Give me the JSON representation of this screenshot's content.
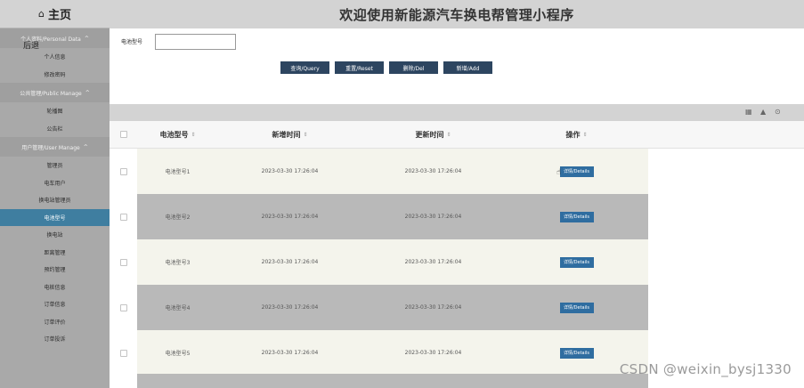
{
  "sidebar": {
    "home_label": "主页",
    "back_label": "后退",
    "groups": [
      {
        "label": "个人资料/Personal Data",
        "items": [
          {
            "label": "个人信息",
            "active": false
          },
          {
            "label": "修改密码",
            "active": false
          }
        ]
      },
      {
        "label": "公共管理/Public Manage",
        "items": [
          {
            "label": "轮播图",
            "active": false
          },
          {
            "label": "公告栏",
            "active": false
          }
        ]
      },
      {
        "label": "用户管理/User Manage",
        "items": [
          {
            "label": "管理员",
            "active": false
          },
          {
            "label": "电车用户",
            "active": false
          },
          {
            "label": "换电站管理员",
            "active": false
          },
          {
            "label": "电池型号",
            "active": true
          },
          {
            "label": "换电站",
            "active": false
          },
          {
            "label": "距离管理",
            "active": false
          },
          {
            "label": "预约管理",
            "active": false
          },
          {
            "label": "电桩信息",
            "active": false
          },
          {
            "label": "订单信息",
            "active": false
          },
          {
            "label": "订单评价",
            "active": false
          },
          {
            "label": "订单投诉",
            "active": false
          }
        ]
      }
    ]
  },
  "header": {
    "title": "欢迎使用新能源汽车换电帮管理小程序"
  },
  "search": {
    "label": "电池型号",
    "value": "",
    "placeholder": ""
  },
  "buttons": {
    "query": "查询/Query",
    "reset": "重置/Reset",
    "del": "删除/Del",
    "add": "新增/Add"
  },
  "table": {
    "columns": [
      "电池型号",
      "新增时间",
      "更新时间",
      "操作"
    ],
    "sort_glyph": "⇕",
    "detail_label": "详情/Details",
    "rows": [
      {
        "type": "电池型号1",
        "added": "2023-03-30 17:26:04",
        "updated": "2023-03-30 17:26:04"
      },
      {
        "type": "电池型号2",
        "added": "2023-03-30 17:26:04",
        "updated": "2023-03-30 17:26:04"
      },
      {
        "type": "电池型号3",
        "added": "2023-03-30 17:26:04",
        "updated": "2023-03-30 17:26:04"
      },
      {
        "type": "电池型号4",
        "added": "2023-03-30 17:26:04",
        "updated": "2023-03-30 17:26:04"
      },
      {
        "type": "电池型号5",
        "added": "2023-03-30 17:26:04",
        "updated": "2023-03-30 17:26:04"
      }
    ]
  },
  "toolbar_icons": [
    "columns-icon",
    "print-icon",
    "export-icon"
  ],
  "watermark": "CSDN @weixin_bysj1330",
  "colors": {
    "sidebar_bg": "#a9a9a9",
    "active_item": "#3f7ea0",
    "button_dark": "#2d4560",
    "detail_button": "#2f6da0"
  }
}
